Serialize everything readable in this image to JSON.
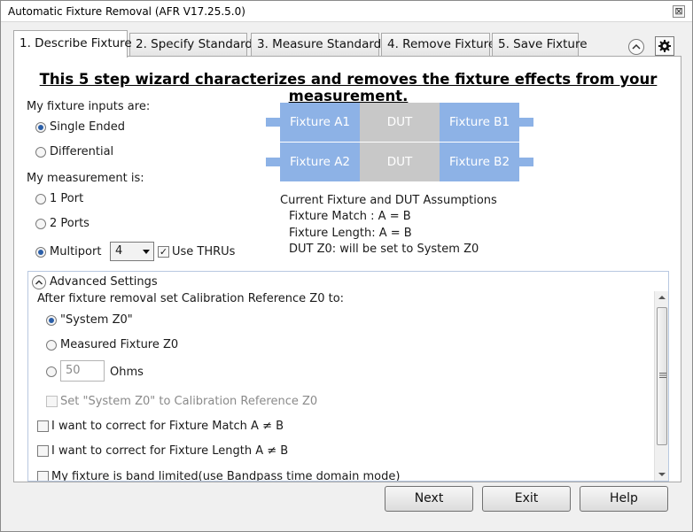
{
  "window": {
    "title": "Automatic Fixture Removal (AFR V17.25.5.0)",
    "close_label": "⊠"
  },
  "tabs": [
    {
      "label": "1. Describe Fixture",
      "active": true
    },
    {
      "label": "2. Specify Standards",
      "active": false
    },
    {
      "label": "3. Measure Standards",
      "active": false
    },
    {
      "label": "4. Remove Fixture",
      "active": false
    },
    {
      "label": "5. Save Fixture",
      "active": false
    }
  ],
  "headline": "This 5 step wizard characterizes and removes the fixture effects from your measurement.",
  "inputs": {
    "label": "My fixture inputs are:",
    "options": [
      {
        "label": "Single Ended",
        "selected": true
      },
      {
        "label": "Differential",
        "selected": false
      }
    ]
  },
  "measurement": {
    "label": "My measurement is:",
    "options": [
      {
        "label": "1 Port",
        "selected": false
      },
      {
        "label": "2 Ports",
        "selected": false
      },
      {
        "label": "Multiport",
        "selected": true
      }
    ],
    "port_count": "4",
    "use_thrus_label": "Use THRUs",
    "use_thrus_checked": true
  },
  "diagram": {
    "row1": [
      "Fixture A1",
      "DUT",
      "Fixture B1"
    ],
    "row2": [
      "Fixture A2",
      "DUT",
      "Fixture B2"
    ],
    "fixture_color": "#8db2e6",
    "dut_color": "#c8c8c8"
  },
  "assumptions": {
    "title": "Current Fixture and DUT Assumptions",
    "lines": [
      "Fixture Match : A = B",
      "Fixture Length: A = B",
      "DUT Z0: will be set to System Z0"
    ]
  },
  "advanced": {
    "title": "Advanced Settings",
    "ref_label": "After fixture removal set Calibration Reference Z0 to:",
    "ref_options": [
      {
        "label": "\"System Z0\"",
        "selected": true
      },
      {
        "label": "Measured Fixture Z0",
        "selected": false
      }
    ],
    "ohms_value": "50",
    "ohms_unit": "Ohms",
    "set_system_label": "Set \"System Z0\" to Calibration Reference Z0",
    "checks": [
      "I want to correct for Fixture Match A ≠ B",
      "I want to correct for Fixture Length A ≠ B",
      "My fixture is band limited(use Bandpass time domain mode)"
    ]
  },
  "buttons": {
    "next": "Next",
    "exit": "Exit",
    "help": "Help"
  }
}
